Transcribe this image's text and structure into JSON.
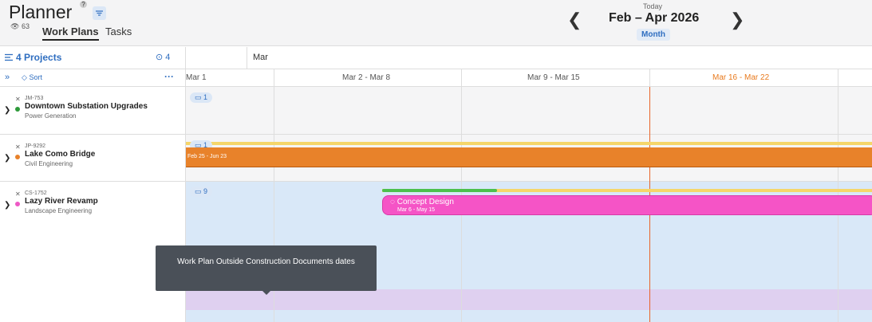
{
  "header": {
    "title": "Planner",
    "help_glyph": "?",
    "views_count": "63",
    "tabs": [
      {
        "label": "Work Plans"
      },
      {
        "label": "Tasks"
      }
    ],
    "today_label": "Today",
    "date_range": "Feb – Apr 2026",
    "view_mode": "Month",
    "prev_glyph": "❮",
    "next_glyph": "❯"
  },
  "sidebar": {
    "projects_label": "4 Projects",
    "assignees_count": "4",
    "sort_label": "Sort",
    "more_glyph": "···",
    "expand_glyph": "»",
    "projects": [
      {
        "code": "JM-753",
        "name": "Downtown Substation Upgrades",
        "dept": "Power Generation",
        "dot_color": "#2e9a3a",
        "task_count": "1"
      },
      {
        "code": "JP-9292",
        "name": "Lake Como Bridge",
        "dept": "Civil Engineering",
        "dot_color": "#e8822a",
        "task_count": "1"
      },
      {
        "code": "CS-1752",
        "name": "Lazy River Revamp",
        "dept": "Landscape Engineering",
        "dot_color": "#ee59c5",
        "task_count": "9"
      }
    ]
  },
  "timeline": {
    "month_label": "Mar",
    "weeks": [
      "Mar 1",
      "Mar 2 - Mar 8",
      "Mar 9 - Mar 15",
      "Mar 16 - Mar 22"
    ],
    "current_week_color": "#e87a1e",
    "bridge_bar": {
      "label": "Feb 25 - Jun 23",
      "color": "#e8822a"
    },
    "concept_bar": {
      "title": "Concept Design",
      "dates": "Mar 6 - May 15",
      "color": "#f554c6"
    }
  },
  "tooltip": {
    "text": "Work Plan Outside Construction Documents dates"
  }
}
